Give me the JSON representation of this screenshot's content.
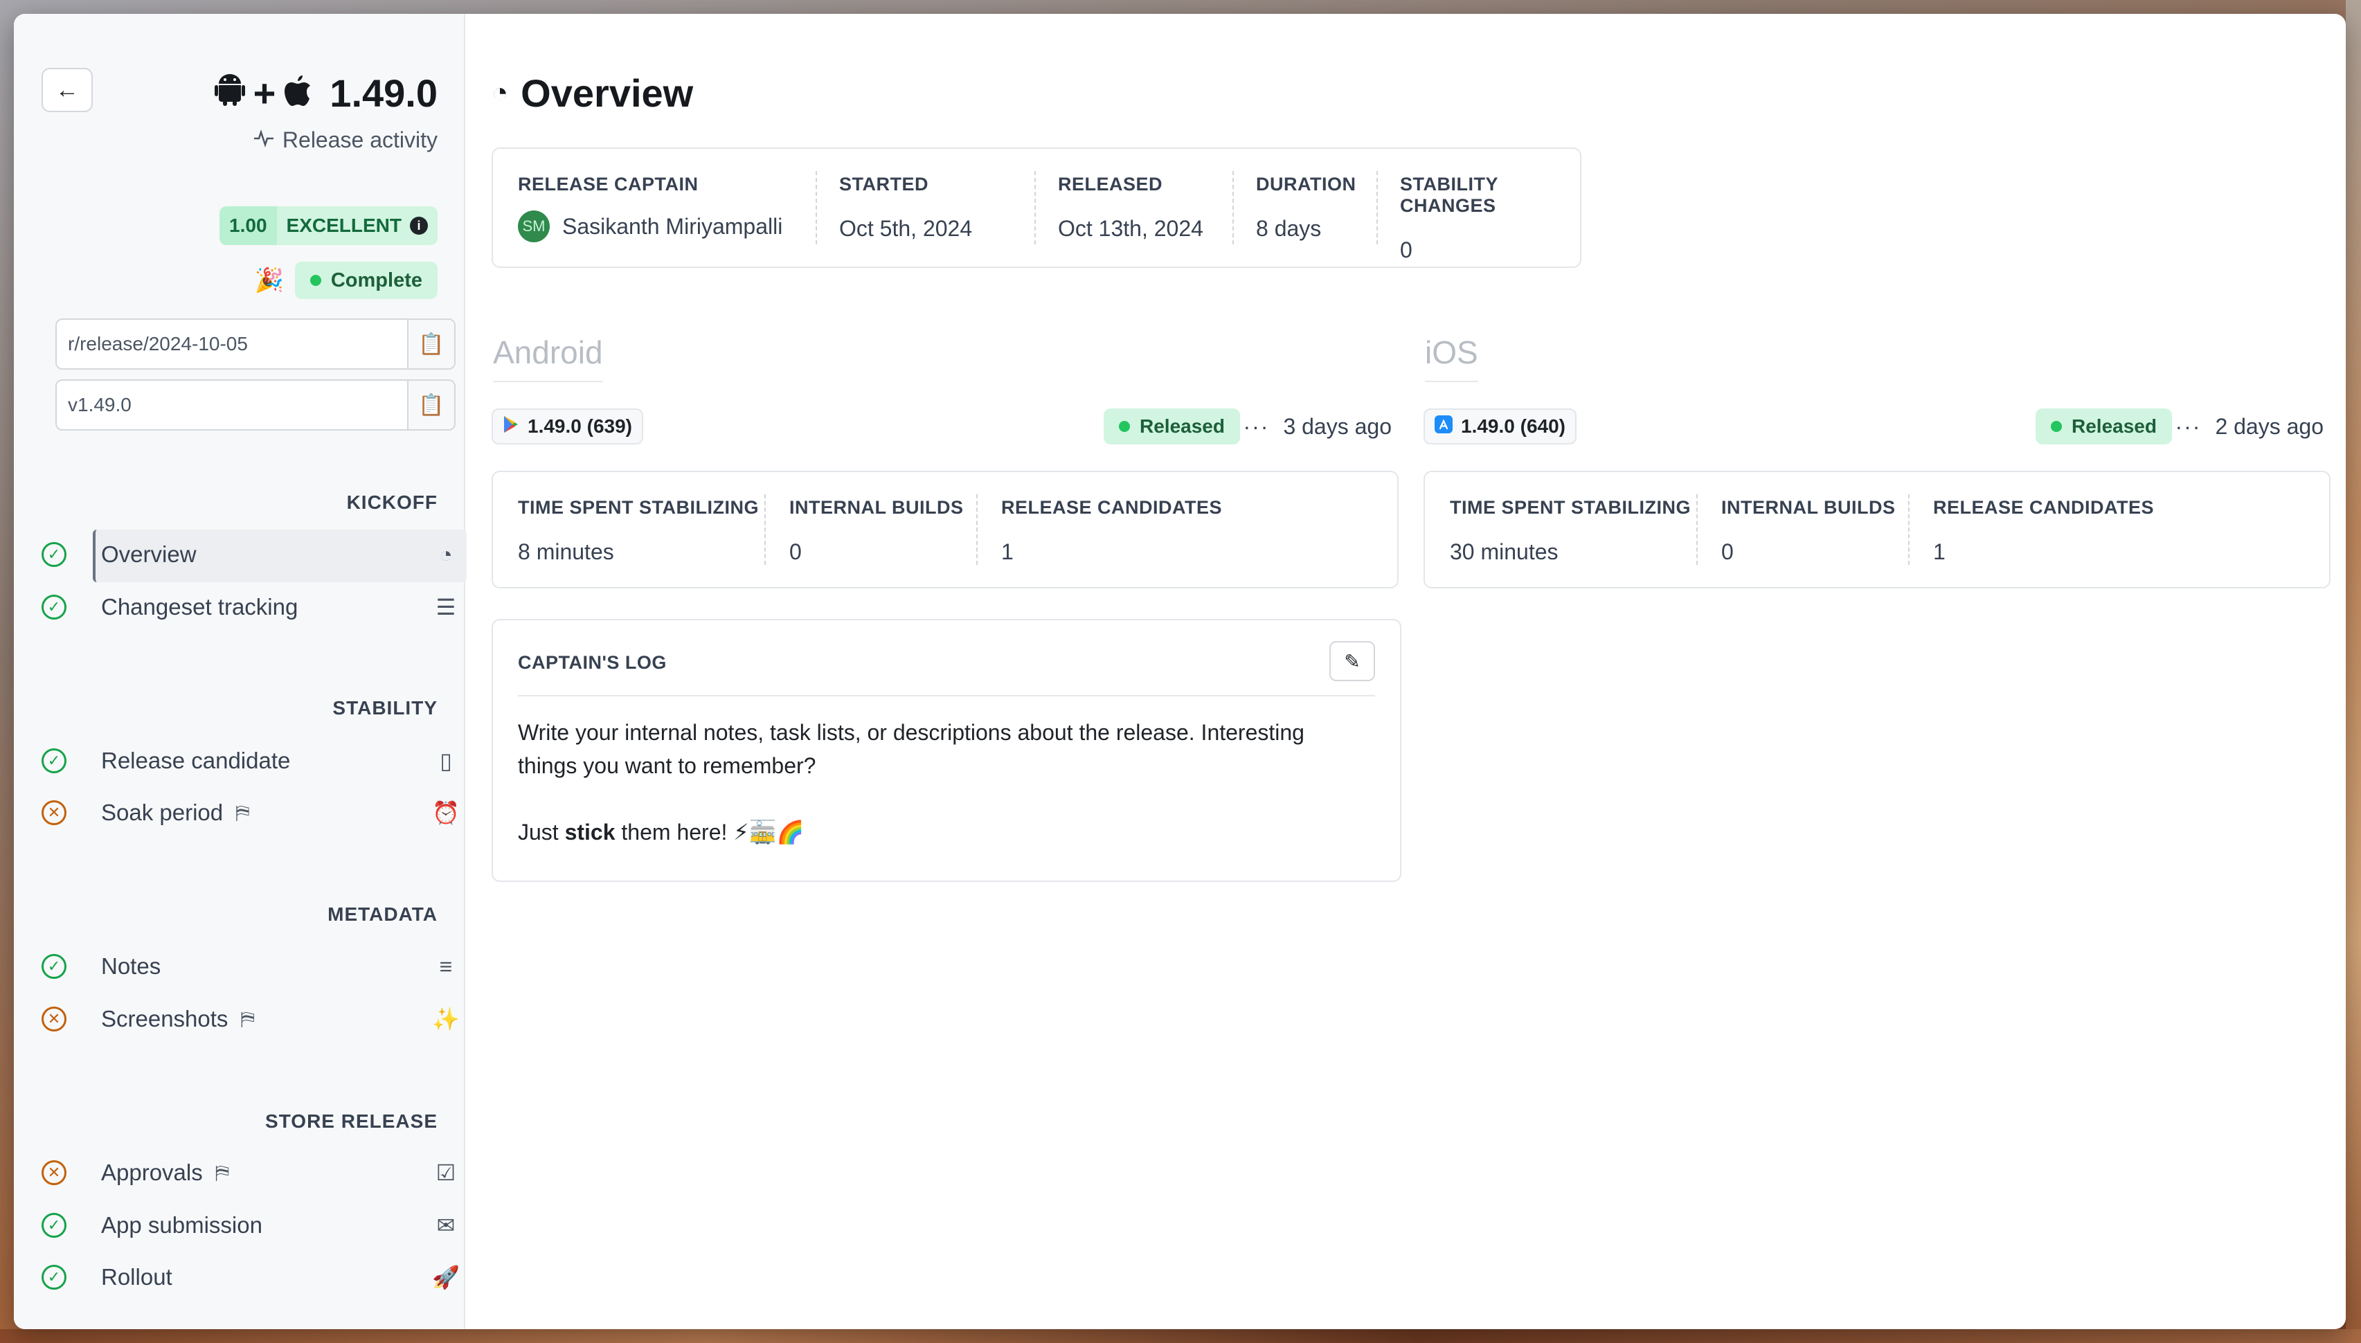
{
  "sidebar": {
    "version_title": "+ 1.49.0",
    "release_activity": "Release activity",
    "score": {
      "value": "1.00",
      "grade": "EXCELLENT"
    },
    "status": "Complete",
    "branch": "r/release/2024-10-05",
    "tag": "v1.49.0",
    "sections": [
      {
        "label": "KICKOFF",
        "items": [
          {
            "label": "Overview",
            "state": "ok",
            "trailing_icon": "gauge-icon"
          },
          {
            "label": "Changeset tracking",
            "state": "ok",
            "trailing_icon": "list-music-icon"
          }
        ]
      },
      {
        "label": "STABILITY",
        "items": [
          {
            "label": "Release candidate",
            "state": "ok",
            "trailing_icon": "gallery-icon"
          },
          {
            "label": "Soak period",
            "state": "fail",
            "blocker": true,
            "trailing_icon": "alarm-clock-icon"
          }
        ]
      },
      {
        "label": "METADATA",
        "items": [
          {
            "label": "Notes",
            "state": "ok",
            "trailing_icon": "text-lines-icon"
          },
          {
            "label": "Screenshots",
            "state": "fail",
            "blocker": true,
            "trailing_icon": "magic-wand-icon"
          }
        ]
      },
      {
        "label": "STORE RELEASE",
        "items": [
          {
            "label": "Approvals",
            "state": "fail",
            "blocker": true,
            "trailing_icon": "checklist-icon"
          },
          {
            "label": "App submission",
            "state": "ok",
            "trailing_icon": "mail-icon"
          },
          {
            "label": "Rollout",
            "state": "ok",
            "trailing_icon": "rocket-icon"
          }
        ]
      }
    ]
  },
  "overview": {
    "title": "Overview",
    "summary": {
      "captain_label": "RELEASE CAPTAIN",
      "captain_initials": "SM",
      "captain_name": "Sasikanth Miriyampalli",
      "started_label": "STARTED",
      "started": "Oct 5th, 2024",
      "released_label": "RELEASED",
      "released": "Oct 13th, 2024",
      "duration_label": "DURATION",
      "duration": "8 days",
      "stability_label": "STABILITY CHANGES",
      "stability_changes": "0"
    },
    "android": {
      "heading": "Android",
      "build": "1.49.0 (639)",
      "status": "Released",
      "ago": "3 days ago",
      "stabilizing_label": "TIME SPENT STABILIZING",
      "stabilizing": "8 minutes",
      "internal_label": "INTERNAL BUILDS",
      "internal": "0",
      "rc_label": "RELEASE CANDIDATES",
      "rc": "1"
    },
    "ios": {
      "heading": "iOS",
      "build": "1.49.0 (640)",
      "status": "Released",
      "ago": "2 days ago",
      "stabilizing_label": "TIME SPENT STABILIZING",
      "stabilizing": "30 minutes",
      "internal_label": "INTERNAL BUILDS",
      "internal": "0",
      "rc_label": "RELEASE CANDIDATES",
      "rc": "1"
    },
    "captains_log": {
      "title": "CAPTAIN'S LOG",
      "line1": "Write your internal notes, task lists, or descriptions about the release. Interesting things you want to remember?",
      "line2_pre": "Just ",
      "line2_bold": "stick",
      "line2_post": " them here! ⚡🚋🌈"
    }
  },
  "colors": {
    "success": "#22c55e",
    "warning": "#c2610c",
    "badge_bg": "#d1f5e0"
  }
}
